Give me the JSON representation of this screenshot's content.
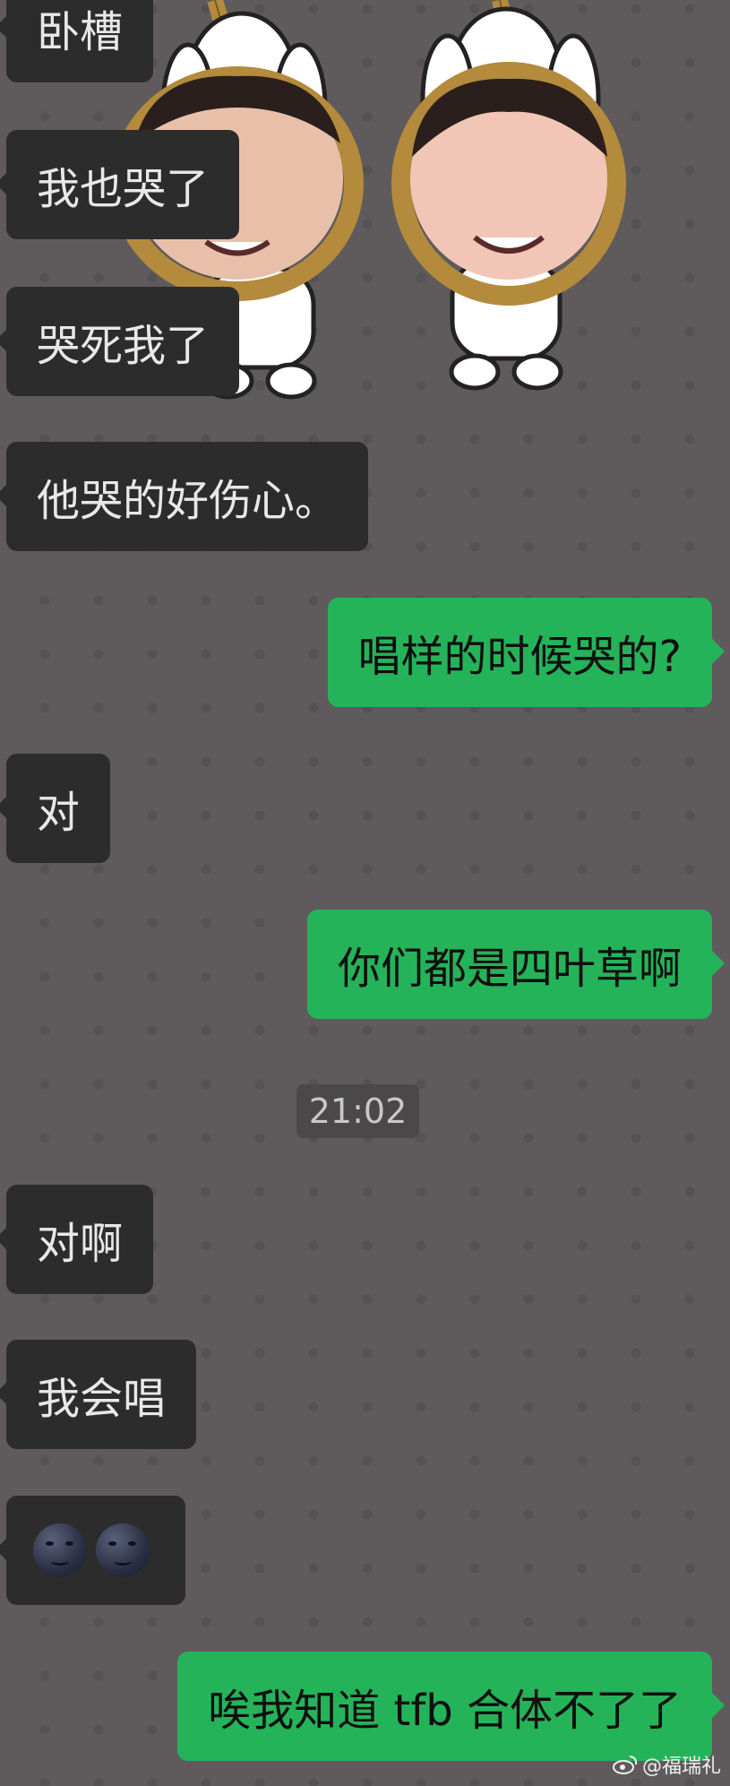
{
  "chat": {
    "messages": [
      {
        "side": "in",
        "text": "卧槽"
      },
      {
        "side": "in",
        "text": "我也哭了"
      },
      {
        "side": "in",
        "text": "哭死我了"
      },
      {
        "side": "in",
        "text": "他哭的好伤心。"
      },
      {
        "side": "out",
        "text": "唱样的时候哭的?"
      },
      {
        "side": "in",
        "text": "对"
      },
      {
        "side": "out",
        "text": "你们都是四叶草啊"
      },
      {
        "side": "in",
        "text": "对啊"
      },
      {
        "side": "in",
        "text": "我会唱"
      },
      {
        "side": "in",
        "emoji": [
          "new-moon-face",
          "new-moon-face"
        ]
      },
      {
        "side": "out",
        "text": "唉我知道 tfb 合体不了了"
      }
    ],
    "timestamp": "21:02"
  },
  "watermark": {
    "text": "@福瑞礼",
    "icon": "weibo-icon"
  },
  "colors": {
    "background": "#5f5b5c",
    "incoming_bubble": "#2c2c2c",
    "outgoing_bubble": "#25b35a"
  }
}
